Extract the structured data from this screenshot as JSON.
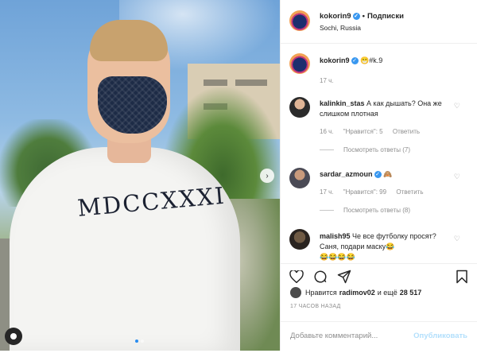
{
  "post": {
    "username": "kokorin9",
    "follow_label": "Подписки",
    "location": "Sochi, Russia",
    "shirt_text": "MDCCXXXI",
    "caption": "😁#k.9",
    "caption_time": "17 ч."
  },
  "comments": [
    {
      "user": "kalinkin_stas",
      "text": "А как дышать? Она же слишком плотная",
      "time": "16 ч.",
      "likes": "\"Нравится\": 5",
      "reply": "Ответить",
      "view_replies": "Посмотреть ответы (7)"
    },
    {
      "user": "sardar_azmoun",
      "text": "🙈",
      "time": "17 ч.",
      "likes": "\"Нравится\": 99",
      "reply": "Ответить",
      "view_replies": "Посмотреть ответы (8)"
    },
    {
      "user": "malish95",
      "text": "Че все футболку просят? Саня, подари маску😂",
      "emoji_line": "😂😂😂😂"
    }
  ],
  "likes": {
    "prefix": "Нравится",
    "user": "radimov02",
    "suffix": "и ещё",
    "count": "28 517"
  },
  "time_ago": "17 ЧАСОВ НАЗАД",
  "comment_box": {
    "placeholder": "Добавьте комментарий...",
    "publish_label": "Опубликовать"
  },
  "icons": [
    "verified-icon",
    "heart-icon",
    "comment-icon",
    "share-icon",
    "bookmark-icon",
    "next-arrow-icon",
    "user-tag-icon"
  ],
  "colors": {
    "verified": "#3897f0",
    "link_disabled": "#b2dffc",
    "muted": "#8e8e8e"
  }
}
